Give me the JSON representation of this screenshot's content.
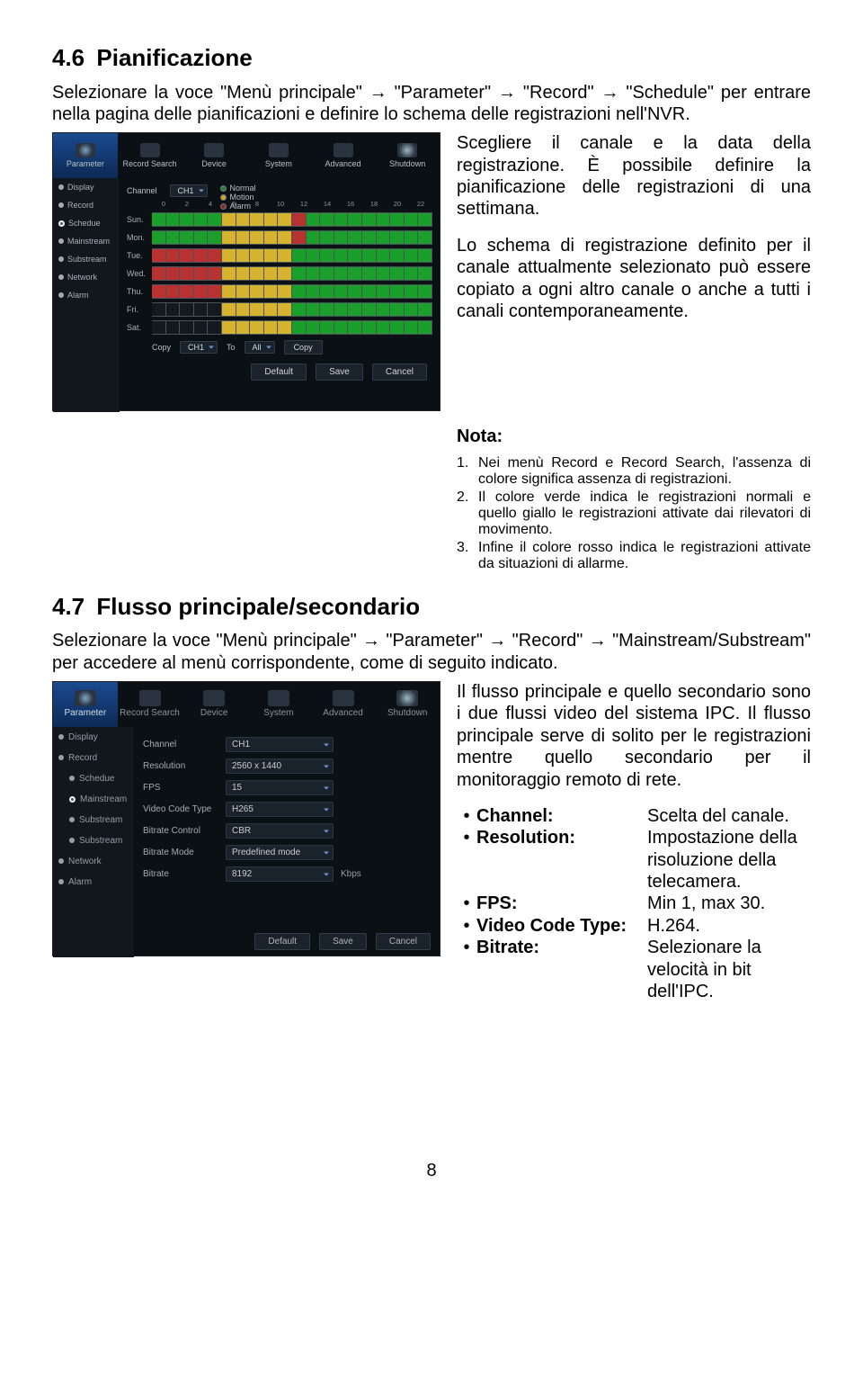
{
  "section46": {
    "num": "4.6",
    "title": "Pianificazione",
    "intro": "Selezionare la voce \"Menù principale\" → \"Parameter\" → \"Record\" → \"Schedule\" per entrare nella pagina delle pianificazioni e definire lo schema delle registrazioni nell'NVR.",
    "p1": "Scegliere il canale e la data della registrazione. È possibile definire la pianificazione delle registrazioni di una settimana.",
    "p2": "Lo schema di registrazione definito per il canale attualmente selezionato può essere copiato a ogni altro canale o anche a tutti i canali contemporaneamente.",
    "nota_label": "Nota:",
    "notes": [
      {
        "n": "1.",
        "t": "Nei menù Record e Record Search, l'assenza di colore significa assenza di registrazioni."
      },
      {
        "n": "2.",
        "t": "Il colore verde indica le registrazioni normali e quello giallo le registrazioni attivate dai rilevatori di movimento."
      },
      {
        "n": "3.",
        "t": "Infine il colore rosso indica le registrazioni attivate da situazioni di allarme."
      }
    ]
  },
  "section47": {
    "num": "4.7",
    "title": "Flusso principale/secondario",
    "intro": "Selezionare la voce \"Menù principale\" → \"Parameter\" → \"Record\" → \"Mainstream/Substream\" per accedere al menù corrispondente, come di seguito indicato.",
    "p1": "Il flusso principale e quello secondario sono i due flussi video del sistema IPC. Il flusso principale serve di solito per le registrazioni mentre quello secondario per il monitoraggio remoto di rete.",
    "bullets": [
      {
        "k": "Channel:",
        "v": "Scelta del canale."
      },
      {
        "k": "Resolution:",
        "v": "Impostazione della risoluzione della telecamera."
      },
      {
        "k": "FPS:",
        "v": "Min 1, max 30."
      },
      {
        "k": "Video Code Type:",
        "v": "H.264."
      },
      {
        "k": "Bitrate:",
        "v": "Selezionare la velocità in bit dell'IPC."
      }
    ]
  },
  "shot1": {
    "toolbar": [
      "Parameter",
      "Record Search",
      "Device",
      "System",
      "Advanced",
      "Shutdown"
    ],
    "sidebar": [
      "Display",
      "Record",
      "Schedue",
      "Mainstream",
      "Substream",
      "Network",
      "Alarm"
    ],
    "channel_row": {
      "label": "Channel",
      "value": "CH1"
    },
    "legend": {
      "n": "Normal",
      "m": "Motion",
      "a": "Alarm"
    },
    "hours": [
      "0",
      "2",
      "4",
      "6",
      "8",
      "10",
      "12",
      "14",
      "16",
      "18",
      "20",
      "22"
    ],
    "days": [
      "Sun.",
      "Mon.",
      "Tue.",
      "Wed.",
      "Thu.",
      "Fri.",
      "Sat."
    ],
    "grid": [
      "nnnnnmmmmmannnnnnnnn",
      "nnnnnmmmmmannnnnnnnn",
      "aaaaammmmmnnnnnnnnnn",
      "aaaaammmmmnnnnnnnnnn",
      "aaaaammmmmnnnnnnnnnn",
      "eeeeemmmmmnnnnnnnnnn",
      "eeeeemmmmmnnnnnnnnnn"
    ],
    "copybar": {
      "copy_label": "Copy",
      "ch": "CH1",
      "to_label": "To",
      "to_val": "All",
      "btn": "Copy"
    },
    "buttons": [
      "Default",
      "Save",
      "Cancel"
    ]
  },
  "shot2": {
    "toolbar": [
      "Parameter",
      "Record Search",
      "Device",
      "System",
      "Advanced",
      "Shutdown"
    ],
    "sidebar": [
      "Display",
      "Record",
      "Schedue",
      "Mainstream",
      "Substream",
      "Substream",
      "Network",
      "Alarm"
    ],
    "fields": [
      {
        "lbl": "Channel",
        "val": "CH1",
        "unit": ""
      },
      {
        "lbl": "Resolution",
        "val": "2560 x 1440",
        "unit": ""
      },
      {
        "lbl": "FPS",
        "val": "15",
        "unit": ""
      },
      {
        "lbl": "Video Code Type",
        "val": "H265",
        "unit": ""
      },
      {
        "lbl": "Bitrate Control",
        "val": "CBR",
        "unit": ""
      },
      {
        "lbl": "Bitrate Mode",
        "val": "Predefined mode",
        "unit": ""
      },
      {
        "lbl": "Bitrate",
        "val": "8192",
        "unit": "Kbps"
      }
    ],
    "buttons": [
      "Default",
      "Save",
      "Cancel"
    ]
  },
  "pagenum": "8"
}
